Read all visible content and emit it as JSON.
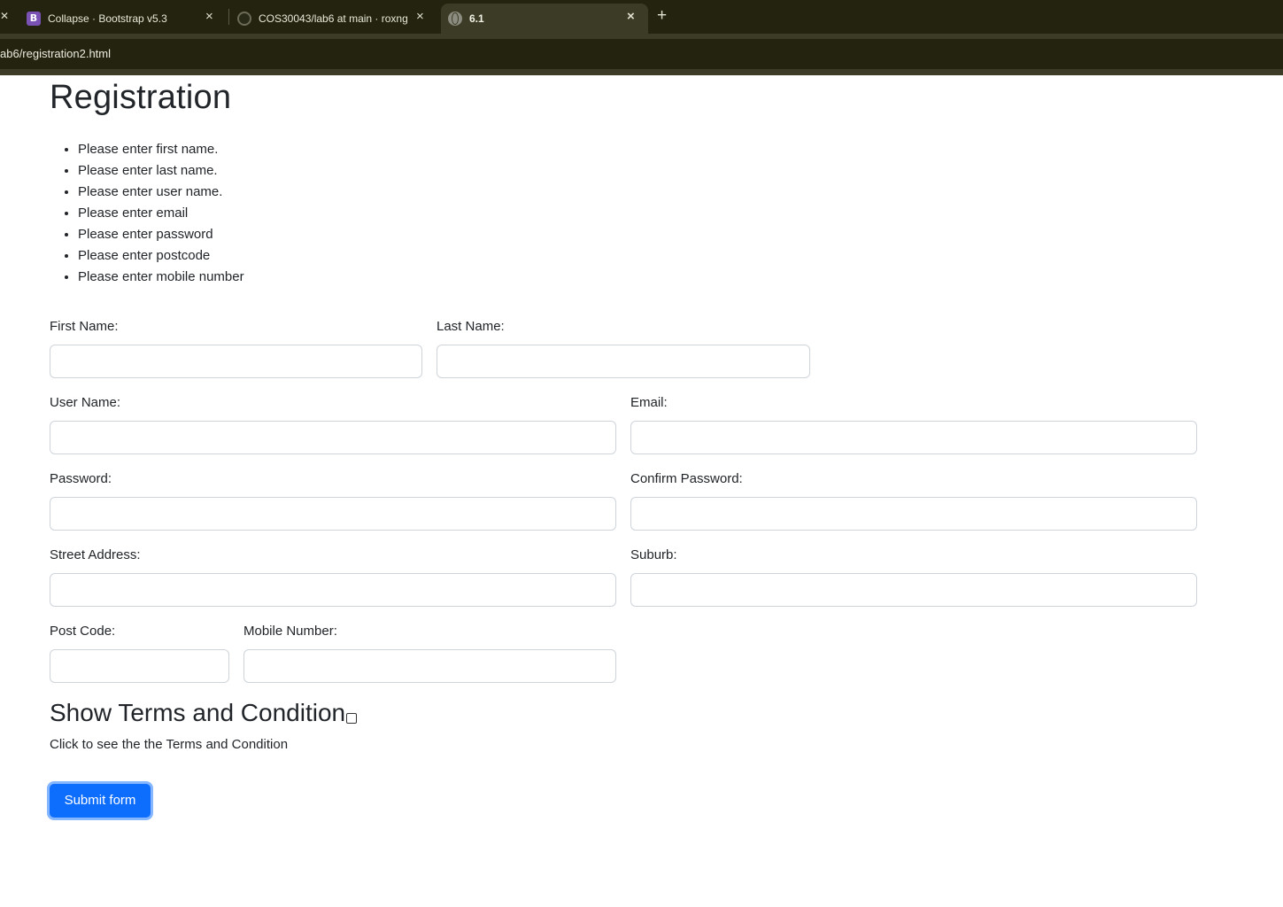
{
  "browser": {
    "tabs": [
      {
        "title": "Collapse · Bootstrap v5.3",
        "icon": "bootstrap-icon",
        "icon_glyph": "B",
        "active": false
      },
      {
        "title": "COS30043/lab6 at main · roxng",
        "icon": "github-icon",
        "active": false
      },
      {
        "title": "6.1",
        "icon": "globe-icon",
        "active": true
      }
    ],
    "close_glyph": "×",
    "new_tab_glyph": "+",
    "url": "ab6/registration2.html"
  },
  "page": {
    "title": "Registration",
    "errors": [
      "Please enter first name.",
      "Please enter last name.",
      "Please enter user name.",
      "Please enter email",
      "Please enter password",
      "Please enter postcode",
      "Please enter mobile number"
    ],
    "fields": {
      "first_name": {
        "label": "First Name:",
        "value": ""
      },
      "last_name": {
        "label": "Last Name:",
        "value": ""
      },
      "user_name": {
        "label": "User Name:",
        "value": ""
      },
      "email": {
        "label": "Email:",
        "value": ""
      },
      "password": {
        "label": "Password:",
        "value": ""
      },
      "confirm_password": {
        "label": "Confirm Password:",
        "value": ""
      },
      "street_address": {
        "label": "Street Address:",
        "value": ""
      },
      "suburb": {
        "label": "Suburb:",
        "value": ""
      },
      "post_code": {
        "label": "Post Code:",
        "value": ""
      },
      "mobile_number": {
        "label": "Mobile Number:",
        "value": ""
      }
    },
    "terms_heading": "Show Terms and Condition",
    "terms_checked": false,
    "terms_hint": "Click to see the the Terms and Condition",
    "submit_label": "Submit form"
  },
  "colors": {
    "chrome_dark": "#23230f",
    "chrome_active": "#3c3c26",
    "primary": "#0d6efd",
    "focus_ring": "#86b7fe",
    "input_border": "#ced4da"
  }
}
